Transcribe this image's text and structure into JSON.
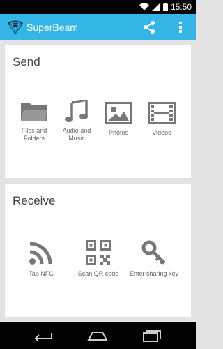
{
  "status_bar": {
    "time": "15:50"
  },
  "app_bar": {
    "title": "SuperBeam",
    "share_icon": "share-icon",
    "overflow_icon": "overflow-menu-icon"
  },
  "send": {
    "title": "Send",
    "items": [
      {
        "label_line1": "Files and",
        "label_line2": "Folders",
        "icon": "folder-icon"
      },
      {
        "label_line1": "Audio and",
        "label_line2": "Music",
        "icon": "music-note-icon"
      },
      {
        "label_line1": "Photos",
        "label_line2": "",
        "icon": "photo-icon"
      },
      {
        "label_line1": "Videos",
        "label_line2": "",
        "icon": "film-icon"
      }
    ]
  },
  "receive": {
    "title": "Receive",
    "items": [
      {
        "label": "Tap NFC",
        "icon": "nfc-icon"
      },
      {
        "label": "Scan QR code",
        "icon": "qr-code-icon"
      },
      {
        "label": "Enter sharing key",
        "icon": "key-icon"
      }
    ]
  },
  "colors": {
    "accent": "#33b5e5",
    "card_bg": "#ffffff",
    "page_bg": "#e3e3e3",
    "icon_gray": "#777777"
  }
}
